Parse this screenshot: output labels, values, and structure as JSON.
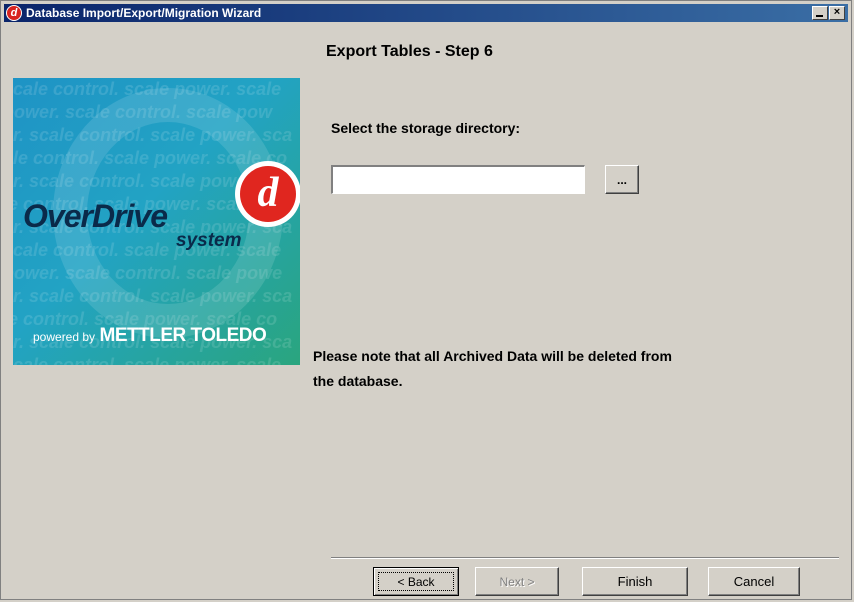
{
  "window": {
    "title": "Database Import/Export/Migration Wizard",
    "app_icon_glyph": "d"
  },
  "wizard": {
    "step_title": "Export Tables - Step 6",
    "directory_label": "Select the storage directory:",
    "directory_value": "",
    "browse_label": "...",
    "note_line1": "Please note that all Archived Data will be deleted from",
    "note_line2": "the database."
  },
  "logo": {
    "brand": "OverDrive",
    "sub": "system",
    "powered_by": "powered by",
    "company": "METTLER TOLEDO",
    "d_glyph": "d",
    "pattern_lines": [
      "scale control. scale power. scale",
      "power. scale control. scale pow",
      "er. scale control. scale power. sca",
      "ale control. scale power. scale co",
      "er. scale control. scale power. sca",
      "le control. scale power. scale co",
      "er. scale control. scale power. sca",
      "scale control. scale power. scale",
      "power. scale control. scale powe",
      "er. scale control. scale power. sca",
      "le control. scale power. scale co",
      "er. scale control. scale power. sca",
      "scale control. scale power. scale"
    ]
  },
  "buttons": {
    "back": "< Back",
    "next": "Next >",
    "finish": "Finish",
    "cancel": "Cancel"
  },
  "title_buttons": {
    "minimize": "minimize",
    "close": "×"
  },
  "colors": {
    "titlebar_start": "#0a246a",
    "titlebar_end": "#3a6ea5",
    "logo_red": "#e0261f",
    "background": "#d4d0c8"
  }
}
